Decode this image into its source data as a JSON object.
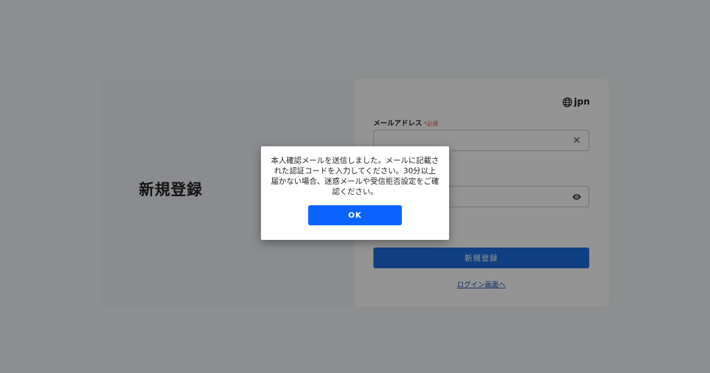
{
  "register_card": {
    "title": "新規登録",
    "language": {
      "label": "jpn",
      "icon": "globe-icon"
    },
    "email_field": {
      "label": "メールアドレス",
      "required_mark": "*必須",
      "value": "",
      "placeholder": "",
      "clear_icon": "close-icon"
    },
    "password_field": {
      "value": "",
      "toggle_icon": "eye-icon"
    },
    "submit_label": "新規登録",
    "login_link": "ログイン画面へ"
  },
  "dialog": {
    "message": "本人確認メールを送信しました。メールに記載された認証コードを入力してください。30分以上届かない場合、迷惑メールや受信拒否設定をご確認ください。",
    "ok_label": "OK"
  },
  "colors": {
    "primary": "#1e6fe0",
    "dialog_button": "#0a63ff",
    "required": "#e53935",
    "overlay": "rgba(0,0,0,0.42)"
  }
}
